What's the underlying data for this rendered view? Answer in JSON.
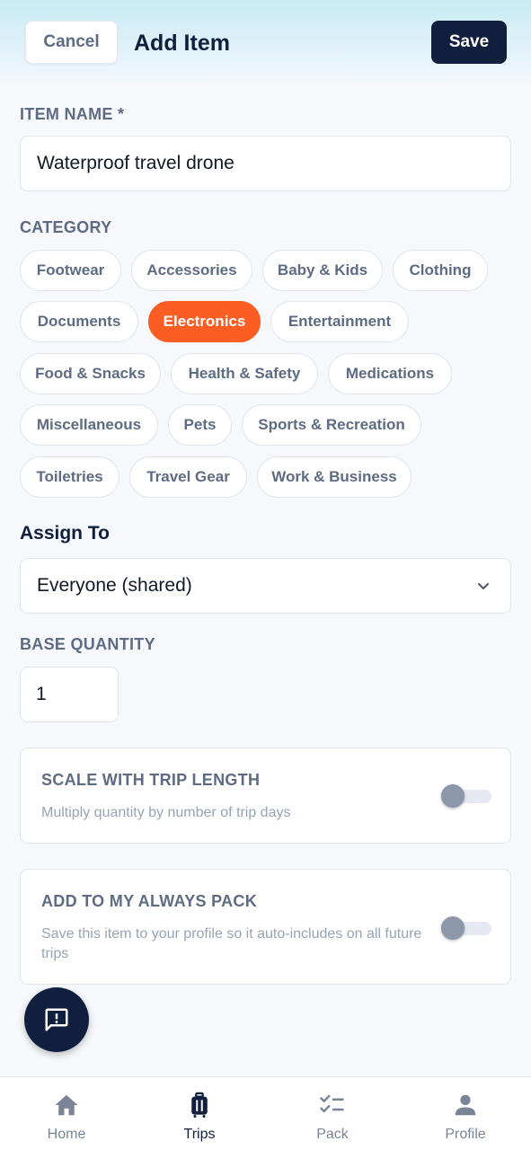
{
  "header": {
    "cancel_label": "Cancel",
    "title": "Add Item",
    "save_label": "Save"
  },
  "item_name": {
    "label": "ITEM NAME *",
    "value": "Waterproof travel drone"
  },
  "category": {
    "label": "CATEGORY",
    "options": [
      "Footwear",
      "Accessories",
      "Baby & Kids",
      "Clothing",
      "Documents",
      "Electronics",
      "Entertainment",
      "Food & Snacks",
      "Health & Safety",
      "Medications",
      "Miscellaneous",
      "Pets",
      "Sports & Recreation",
      "Toiletries",
      "Travel Gear",
      "Work & Business"
    ],
    "selected": "Electronics",
    "selected_color": "#fb5d23"
  },
  "assign_to": {
    "label": "Assign To",
    "value": "Everyone (shared)"
  },
  "base_quantity": {
    "label": "BASE QUANTITY",
    "value": "1"
  },
  "scale_toggle": {
    "title": "SCALE WITH TRIP LENGTH",
    "subtitle": "Multiply quantity by number of trip days",
    "on": false
  },
  "always_pack_toggle": {
    "title": "ADD TO MY ALWAYS PACK",
    "subtitle": "Save this item to your profile so it auto-includes on all future trips",
    "on": false
  },
  "feedback_fab": {
    "icon": "feedback-icon"
  },
  "tabs": [
    {
      "label": "Home",
      "icon": "home-icon",
      "active": false
    },
    {
      "label": "Trips",
      "icon": "suitcase-icon",
      "active": true
    },
    {
      "label": "Pack",
      "icon": "checklist-icon",
      "active": false
    },
    {
      "label": "Profile",
      "icon": "person-icon",
      "active": false
    }
  ],
  "colors": {
    "navy": "#0f1f3d",
    "accent": "#fb5d23",
    "muted": "#5e6b82"
  }
}
